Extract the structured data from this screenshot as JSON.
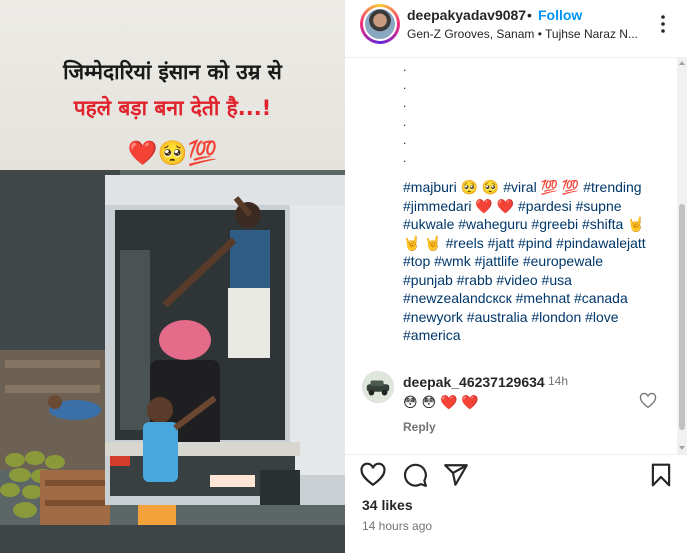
{
  "post": {
    "caption_line1": "जिम्मेदारियां इंसान को उम्र से",
    "caption_line2": "पहले बड़ा बना देती है...!",
    "caption_emojis": "❤️🥺💯"
  },
  "header": {
    "username": "deepakyadav9087",
    "separator": "•",
    "follow_label": "Follow",
    "audio": "Gen-Z Grooves, Sanam • Tujhse Naraz N...",
    "more_icon": "more-options-icon"
  },
  "caption": {
    "dots": [
      ".",
      ".",
      ".",
      ".",
      ".",
      "."
    ],
    "hashtags_lines": [
      "#majburi 🥺 🥺 #viral 💯 💯 #trending",
      "#jimmedari ❤️ ❤️ #pardesi #supne",
      "#ukwale #waheguru #greebi #shifta 🤘",
      "🤘 🤘 #reels #jatt #pind #pindawalejatt",
      "#top #wmk #jattlife #europewale",
      "#punjab #rabb #video #usa",
      "#newzealandcкcк #mehnat #canada",
      "#newyork #australia #london #love",
      "#america"
    ]
  },
  "comment": {
    "username": "deepak_46237129634",
    "time": "14h",
    "text": "😳 😳 ❤️ ❤️",
    "reply_label": "Reply",
    "like_icon": "heart-outline-icon"
  },
  "actions": {
    "icons": [
      "heart-icon",
      "comment-icon",
      "share-icon",
      "bookmark-icon"
    ],
    "likes": "34 likes",
    "posted": "14 hours ago"
  },
  "colors": {
    "link_blue": "#0095f6",
    "hashtag_blue": "#00376b",
    "caption_red": "#e0232d",
    "muted_text": "#737373"
  }
}
